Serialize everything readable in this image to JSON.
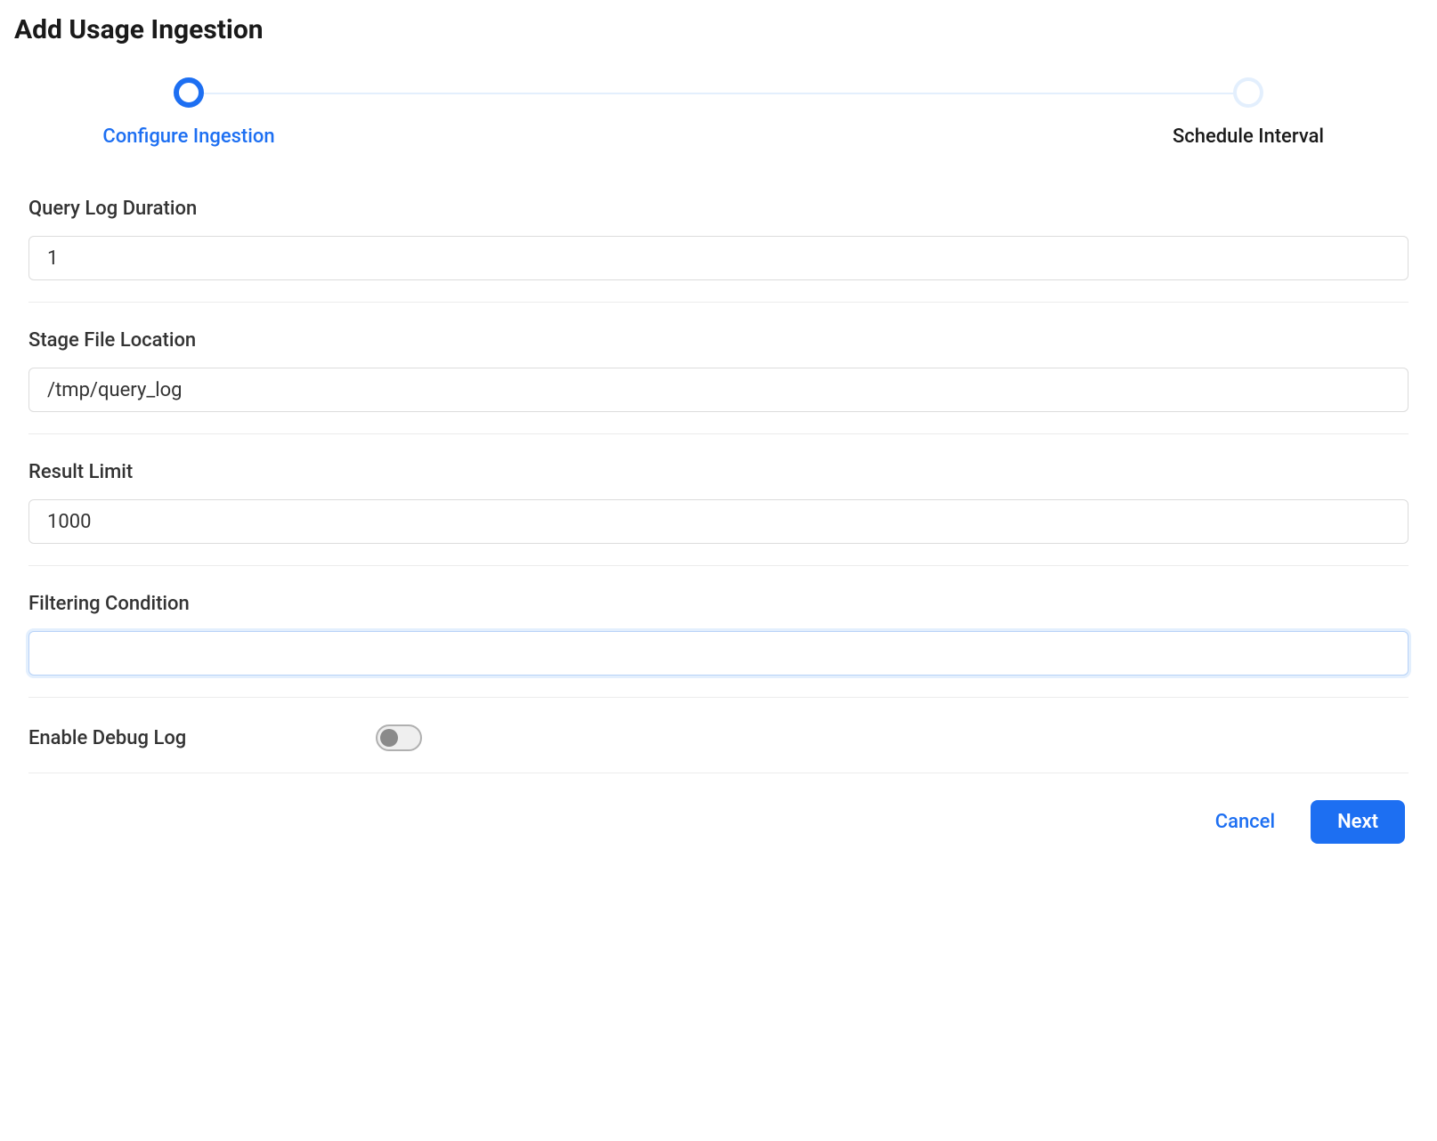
{
  "page": {
    "title": "Add Usage Ingestion"
  },
  "stepper": {
    "step1": {
      "label": "Configure Ingestion"
    },
    "step2": {
      "label": "Schedule Interval"
    }
  },
  "form": {
    "query_log_duration": {
      "label": "Query Log Duration",
      "value": "1"
    },
    "stage_file_location": {
      "label": "Stage File Location",
      "value": "/tmp/query_log"
    },
    "result_limit": {
      "label": "Result Limit",
      "value": "1000"
    },
    "filtering_condition": {
      "label": "Filtering Condition",
      "value": ""
    },
    "enable_debug_log": {
      "label": "Enable Debug Log",
      "value": false
    }
  },
  "buttons": {
    "cancel": "Cancel",
    "next": "Next"
  }
}
